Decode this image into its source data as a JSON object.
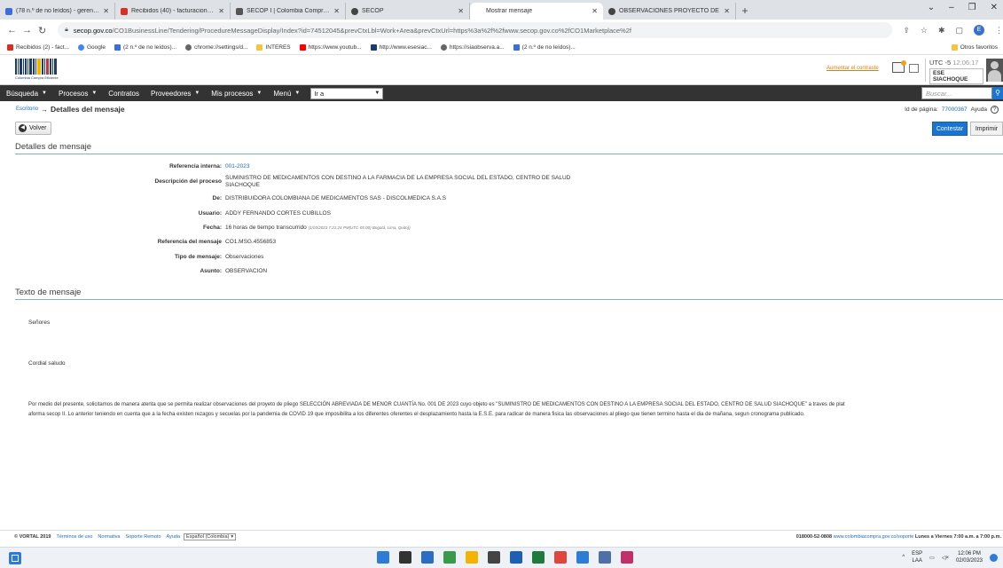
{
  "browser": {
    "tabs": [
      {
        "title": "(78 n.º de no leídos) - gerenciar",
        "color": "#3a6fd8"
      },
      {
        "title": "Recibidos (40) - facturacionesesi",
        "color": "#d93025"
      },
      {
        "title": "SECOP I | Colombia Compra Efic",
        "color": "#555555"
      },
      {
        "title": "SECOP",
        "color": "#444444"
      },
      {
        "title": "Mostrar mensaje",
        "color": "#ffffff"
      },
      {
        "title": "OBSERVACIONES PROYECTO DE",
        "color": "#444444"
      }
    ],
    "url_domain": "secop.gov.co",
    "url_path": "/CO1BusinessLine/Tendering/ProcedureMessageDisplay/Index?id=74512045&prevCtxLbl=Work+Area&prevCtxUrl=https%3a%2f%2fwww.secop.gov.co%2fCO1Marketplace%2f",
    "bookmarks": [
      {
        "label": "Recibidos (2) - fact...",
        "color": "#d93025"
      },
      {
        "label": "Google",
        "color": "#4285f4"
      },
      {
        "label": "(2 n.º de no leídos)...",
        "color": "#3a6fd8"
      },
      {
        "label": "chrome://settings/d...",
        "color": "#666666"
      },
      {
        "label": "INTERES",
        "color": "#f4c542"
      },
      {
        "label": "https://www.youtub...",
        "color": "#ff0000"
      },
      {
        "label": "http://www.esesiac...",
        "color": "#1d3a6e"
      },
      {
        "label": "https://siaobserva.a...",
        "color": "#666666"
      },
      {
        "label": "(2 n.º de no leídos)...",
        "color": "#3a6fd8"
      }
    ],
    "other_bookmarks": "Otros favoritos",
    "profile_initial": "E"
  },
  "header": {
    "logo_text": "Colombia Compra Eficiente",
    "aumentar": "Aumentar el contraste",
    "utc_label": "UTC -5",
    "utc_time": "12:06:17",
    "entity": "ESE SIACHOQUE"
  },
  "nav": {
    "items": [
      "Búsqueda",
      "Procesos",
      "Contratos",
      "Proveedores",
      "Mis procesos",
      "Menú"
    ],
    "ira": "Ir a",
    "search_placeholder": "Buscar..."
  },
  "page": {
    "crumb_link": "Escritorio",
    "title": "Detalles del mensaje",
    "page_id_label": "Id de página:",
    "page_id": "77000367",
    "help": "Ayuda",
    "volver": "Volver",
    "contestar": "Contestar",
    "imprimir": "Imprimir"
  },
  "details": {
    "section": "Detalles de mensaje",
    "rows": [
      {
        "label": "Referencia interna:",
        "value": "001-2023"
      },
      {
        "label": "Descripción del proceso",
        "value": "SUMINISTRO DE MEDICAMENTOS CON DESTINO A LA FARMACIA DE LA EMPRESA SOCIAL DEL ESTADO, CENTRO DE SALUD SIACHOQUE"
      },
      {
        "label": "De:",
        "value": "DISTRIBUIDORA COLOMBIANA DE MEDICAMENTOS SAS - DISCOLMEDICA S.A.S"
      },
      {
        "label": "Usuario:",
        "value": "ADDY FERNANDO CORTES CUBILLOS"
      },
      {
        "label": "Fecha:",
        "value": "16 horas de tiempo transcurrido",
        "note": "(1/03/2023 7:21:24 PM(UTC-05:00) Bogotá, Lima, Quito))"
      },
      {
        "label": "Referencia del mensaje",
        "value": "CO1.MSG.4556853"
      },
      {
        "label": "Tipo de mensaje:",
        "value": "Observaciones"
      },
      {
        "label": "Asunto:",
        "value": "OBSERVACION"
      }
    ]
  },
  "message": {
    "section": "Texto de mensaje",
    "greeting": "Señores",
    "salutation": "Cordial saludo",
    "body_line1": "Por medio del presente, solicitamos de manera atenta que se permita realizar observaciones del proyeto de pliego SELECCIÓN ABREVIADA DE MENOR CUANTÍA No. 001 DE 2023 cuyo objeto es \"SUMINISTRO DE MEDICAMENTOS CON DESTINO A LA EMPRESA SOCIAL DEL ESTADO, CENTRO DE SALUD SIACHOQUE\" a traves de plat",
    "body_line2": "aforma secop II. Lo anterior teniendo en cuenta que a la fecha existen rezagos y secuelas por la pandemia de COVID 19 que imposibilita a los diferentes oferentes el desplazamiento hasta la E.S.E. para radicar de manera fisica las observaciones al pliego que tienen termino hasta el dia de mañana, segun cronograma publicado."
  },
  "footer": {
    "copyright": "© VORTAL 2019",
    "links": [
      "Términos de uso",
      "Normativa",
      "Soporte Remoto",
      "Ayuda"
    ],
    "language": "Español (Colombia)",
    "phone": "018000-52-0808",
    "support_url": "www.colombiacompra.gov.co/soporte",
    "hours": "Lunes a Viernes 7:00 a.m. a 7:00 p.m."
  },
  "taskbar": {
    "lang_top": "ESP",
    "lang_bottom": "LAA",
    "time": "12:06 PM",
    "date": "02/03/2023",
    "app_colors": [
      "#2f7bd8",
      "#333333",
      "#2b6cc4",
      "#3a9a4a",
      "#f2b400",
      "#444444",
      "#1d5fb5",
      "#1e7a3d",
      "#e2453c",
      "#2f7bd8",
      "#4f6fa8",
      "#c0306a"
    ]
  }
}
